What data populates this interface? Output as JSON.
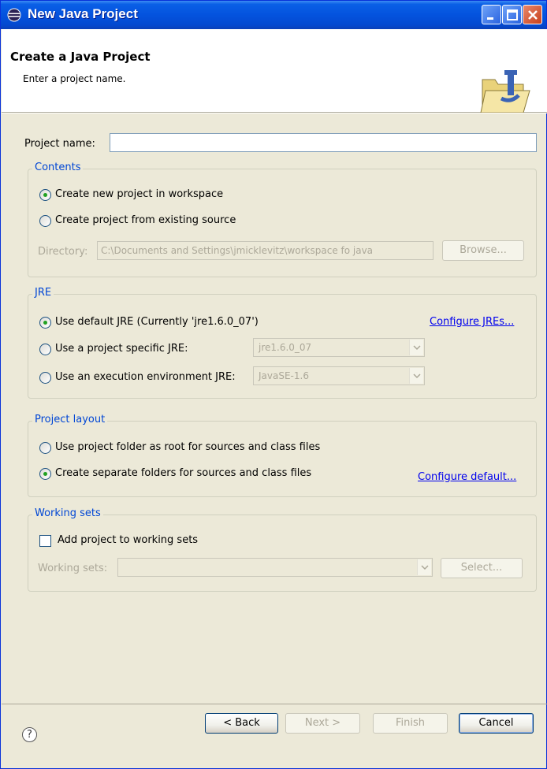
{
  "window": {
    "title": "New Java Project",
    "icon": "eclipse-icon"
  },
  "header": {
    "title": "Create a Java Project",
    "message": "Enter a project name.",
    "icon": "java-folder-icon"
  },
  "project_name": {
    "label": "Project name:",
    "value": ""
  },
  "contents": {
    "title": "Contents",
    "option_new": "Create new project in workspace",
    "option_existing": "Create project from existing source",
    "selected": "option_new",
    "directory_label": "Directory:",
    "directory_value": "C:\\Documents and Settings\\jmicklevitz\\workspace fo java",
    "browse_label": "Browse..."
  },
  "jre": {
    "title": "JRE",
    "option_default": "Use default JRE (Currently 'jre1.6.0_07')",
    "configure_link": "Configure JREs...",
    "option_specific": "Use a project specific JRE:",
    "specific_value": "jre1.6.0_07",
    "option_env": "Use an execution environment JRE:",
    "env_value": "JavaSE-1.6",
    "selected": "option_default"
  },
  "layout": {
    "title": "Project layout",
    "option_root": "Use project folder as root for sources and class files",
    "option_separate": "Create separate folders for sources and class files",
    "configure_link": "Configure default...",
    "selected": "option_separate"
  },
  "working_sets": {
    "title": "Working sets",
    "add_label": "Add project to working sets",
    "add_checked": false,
    "sets_label": "Working sets:",
    "sets_value": "",
    "select_label": "Select..."
  },
  "footer": {
    "help_icon": "help-icon",
    "back_label": "< Back",
    "next_label": "Next >",
    "finish_label": "Finish",
    "cancel_label": "Cancel"
  }
}
